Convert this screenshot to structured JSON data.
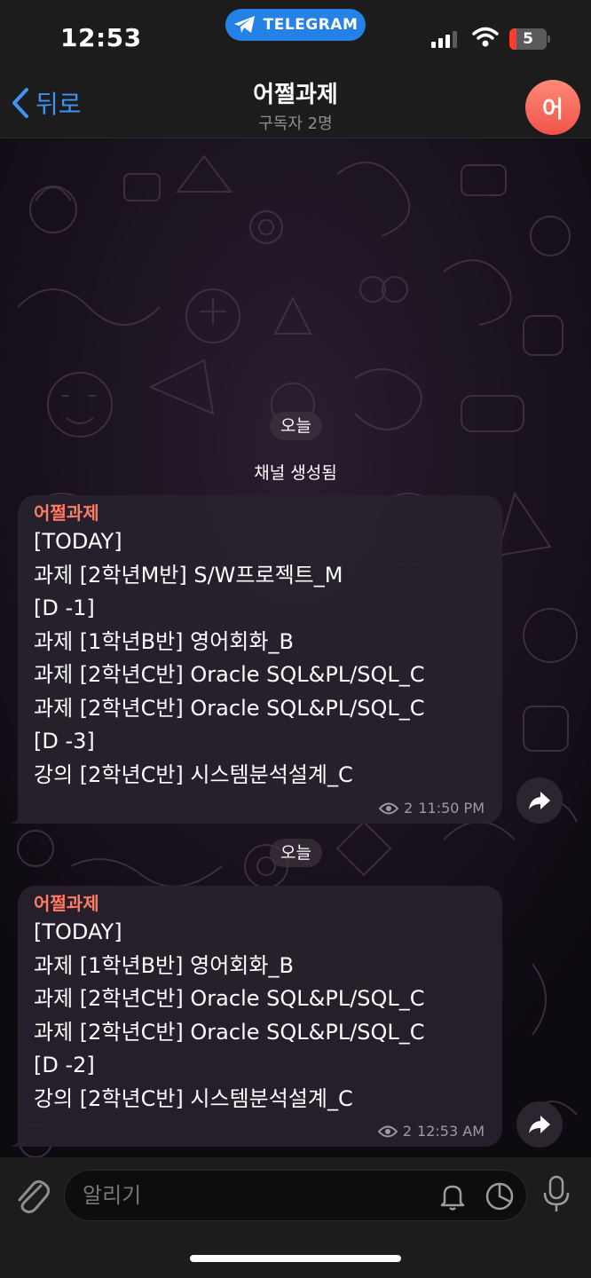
{
  "status_bar": {
    "time": "12:53",
    "pill_label": "TELEGRAM",
    "battery": "5"
  },
  "header": {
    "back_label": "뒤로",
    "title": "어쩔과제",
    "subtitle": "구독자 2명",
    "avatar_letter": "어"
  },
  "chat": {
    "date_1": "오늘",
    "service_message": "채널 생성됨",
    "date_2": "오늘",
    "messages": [
      {
        "sender": "어쩔과제",
        "lines": [
          "[TODAY]",
          "과제 [2학년M반] S/W프로젝트_M",
          "[D -1]",
          "과제 [1학년B반] 영어회화_B",
          "과제 [2학년C반] Oracle SQL&PL/SQL_C",
          "과제 [2학년C반] Oracle SQL&PL/SQL_C",
          "[D -3]",
          "강의 [2학년C반] 시스템분석설계_C"
        ],
        "views": "2",
        "time": "11:50 PM"
      },
      {
        "sender": "어쩔과제",
        "lines": [
          "[TODAY]",
          "과제 [1학년B반] 영어회화_B",
          "과제 [2학년C반] Oracle SQL&PL/SQL_C",
          "과제 [2학년C반] Oracle SQL&PL/SQL_C",
          "[D -2]",
          "강의 [2학년C반] 시스템분석설계_C"
        ],
        "views": "2",
        "time": "12:53 AM"
      }
    ]
  },
  "input": {
    "placeholder": "알리기"
  },
  "colors": {
    "accent": "#3e93f5",
    "sender": "#ff7b64",
    "avatar": "#f0534a",
    "pill": "#2481e6"
  }
}
